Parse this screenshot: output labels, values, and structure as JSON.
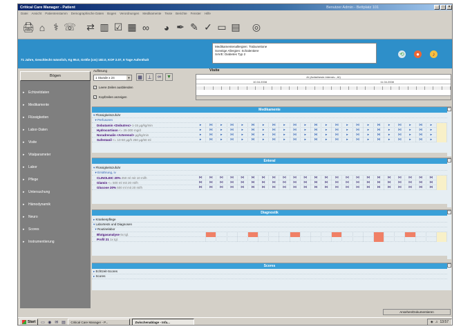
{
  "window": {
    "title": "Critical Care Manager - Patient",
    "title_extra": "Benutzer Admin - Bettplatz 101",
    "min": "_",
    "max": "□",
    "close": "×"
  },
  "menu": [
    "Datei",
    "Ansicht",
    "Patientenstamm",
    "Demographische Daten",
    "Bogen",
    "Verordnungen",
    "Medikamente",
    "Texte",
    "Berichte",
    "Fenster",
    "Hilfe"
  ],
  "toolbar": {
    "icons": [
      "printer-icon",
      "home-icon",
      "stethoscope-icon",
      "phone-icon",
      "swap-icon",
      "book-icon",
      "checklist-icon",
      "calendar-icon",
      "glasses-icon",
      "palette-icon",
      "pen-icon",
      "pencil-icon",
      "check-icon",
      "monitor-icon",
      "document-icon",
      "cd-icon"
    ]
  },
  "patient": {
    "summary": "71 Jahre, Geschlecht männlich, Kg 95.0, Größe (cm) 182.0, KOF 2.07, 6 Tage Aufenthalt",
    "info_lines": [
      "Medikamentenallergien: Trabuneitone",
      "Sonstige Allergien: Schalentiere",
      "SAVE: Diabetes Typ 2"
    ]
  },
  "sidebar": {
    "header": "Bögen",
    "items": [
      "Echtzeitdaten",
      "Medikamente",
      "Flüssigkeiten",
      "Labor-Daten",
      "Visite",
      "Vitalparameter",
      "Labor",
      "Pflege",
      "Untersuchung",
      "Hämodynamik",
      "Neuro",
      "Scores",
      "Instrumentierung"
    ],
    "footer": "Demographische Daten"
  },
  "controls": {
    "aufloesung_label": "Auflösung",
    "interval": "1 Stunde x 24",
    "chk_hide_empty": "Leere Zeilen ausblenden",
    "chk_show_headers": "Kopfzeilen anzeigen"
  },
  "visite": {
    "title": "Visite",
    "bed": "AI (Anästhesie-Intensiv-, AI)",
    "date1": "10.04.2008",
    "date2": "11.04.2008"
  },
  "medikamente": {
    "title": "Medikamente",
    "rows": [
      {
        "label": "Flüssigkeitszufuhr",
        "type": "group"
      },
      {
        "label": "Perfusoren",
        "type": "subgroup"
      },
      {
        "name": "Dobutamin <Dobutrex>",
        "dose": "1-15 µg/kg/min"
      },
      {
        "name": "Hydrocortison",
        "dose": "<= 25-300 mg/d"
      },
      {
        "name": "Noradrenalin <Arterenol>",
        "dose": "µg/kg/min"
      },
      {
        "name": "Sufentanil",
        "dose": "<= 10-50 µg/h 250 µg/50 ml"
      }
    ]
  },
  "enteral": {
    "title": "Enteral",
    "rows": [
      {
        "label": "Flüssigkeitszufuhr",
        "type": "group"
      },
      {
        "label": "Ernährung, iv",
        "type": "subgroup"
      },
      {
        "name": "CLINOLEIC 20%",
        "dose": "250 ml mit 10 ml/h"
      },
      {
        "name": "Glamin",
        "dose": "<= 500 ml mit 20 ml/h"
      },
      {
        "name": "Glucose 20%",
        "dose": "500 ml mit 20 ml/h"
      }
    ]
  },
  "diagnostik": {
    "title": "Diagnostik",
    "rows": [
      {
        "label": "Krankenpflege",
        "type": "group"
      },
      {
        "label": "Labortests und Diagnosen",
        "type": "group"
      },
      {
        "label": "Routinelabor",
        "type": "subgroup"
      },
      {
        "name": "Blutgasanalyse",
        "dose": "6x tgl."
      },
      {
        "name": "Profil 21",
        "dose": "1x tgl."
      }
    ]
  },
  "scores": {
    "title": "Scores",
    "rows": [
      "Echtzeit-Scores",
      "Scores"
    ]
  },
  "bottom": {
    "button": "Ansehen/Dokumentieren"
  },
  "taskbar": {
    "start": "Start",
    "tasks": [
      "Critical Care Manager - P...",
      "Zwischenablage - Infa..."
    ],
    "clock": "13:57"
  }
}
